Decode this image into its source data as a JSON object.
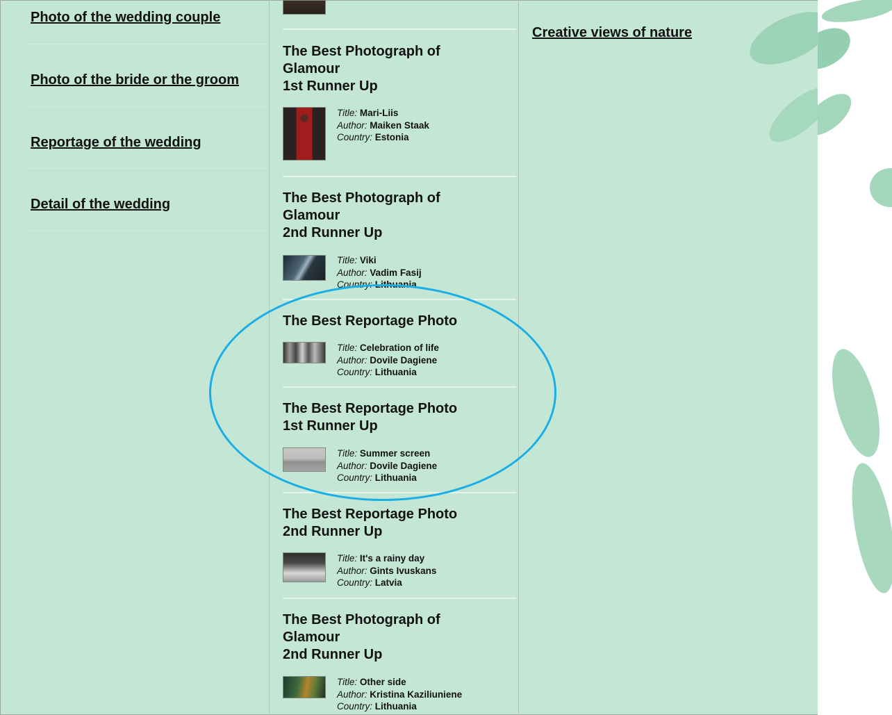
{
  "categories": [
    {
      "label": "Photo of the wedding couple"
    },
    {
      "label": "Photo of the bride or the groom"
    },
    {
      "label": "Reportage of the wedding"
    },
    {
      "label": "Detail of the wedding"
    }
  ],
  "meta_labels": {
    "title": "Title",
    "author": "Author",
    "country": "Country"
  },
  "entries": [
    {
      "title_lines": [
        "The Best Photograph of",
        "Glamour",
        "1st Runner Up"
      ],
      "title": "Mari-Liis",
      "author": "Maiken Staak",
      "country": "Estonia"
    },
    {
      "title_lines": [
        "The Best Photograph of",
        "Glamour",
        "2nd Runner Up"
      ],
      "title": "Viki",
      "author": "Vadim Fasij",
      "country": "Lithuania"
    },
    {
      "title_lines": [
        "The Best Reportage Photo"
      ],
      "title": "Celebration of life",
      "author": "Dovile Dagiene",
      "country": "Lithuania"
    },
    {
      "title_lines": [
        "The Best Reportage Photo",
        "1st Runner Up"
      ],
      "title": "Summer screen",
      "author": "Dovile Dagiene",
      "country": "Lithuania"
    },
    {
      "title_lines": [
        "The Best Reportage Photo",
        "2nd Runner Up"
      ],
      "title": "It's a rainy day",
      "author": "Gints Ivuskans",
      "country": "Latvia"
    },
    {
      "title_lines": [
        "The Best Photograph of",
        "Glamour",
        "2nd Runner Up"
      ],
      "title": "Other side",
      "author": "Kristina Kaziliuniene",
      "country": "Lithuania"
    }
  ],
  "right_column": {
    "link": "Creative views of nature"
  },
  "colors": {
    "background": "#c3e6d5",
    "highlight": "#1aaee6",
    "brush": "#95cfb1"
  }
}
